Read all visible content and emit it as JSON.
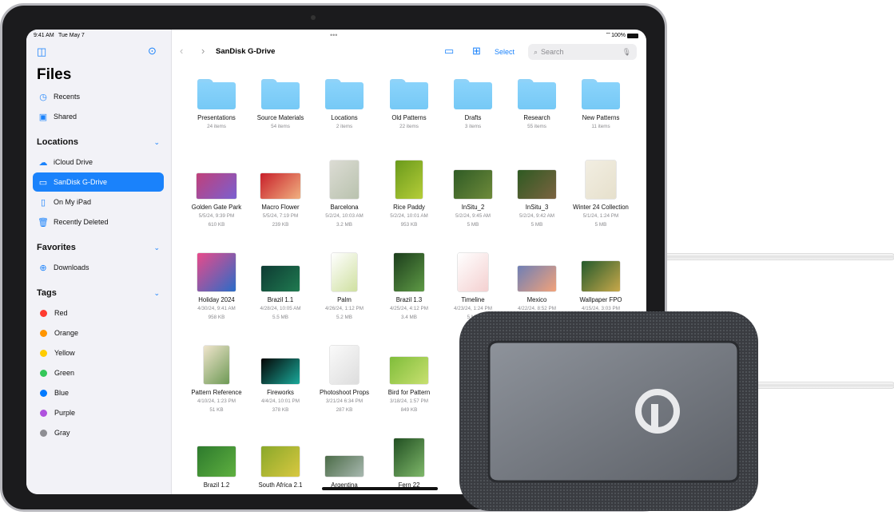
{
  "status": {
    "time": "9:41 AM",
    "date": "Tue May 7",
    "battery": "100%"
  },
  "sidebar": {
    "title": "Files",
    "top": [
      {
        "label": "Recents",
        "icon": "clock-icon"
      },
      {
        "label": "Shared",
        "icon": "shared-folder-icon"
      }
    ],
    "locations_header": "Locations",
    "locations": [
      {
        "label": "iCloud Drive",
        "icon": "cloud-icon"
      },
      {
        "label": "SanDisk G-Drive",
        "icon": "drive-icon",
        "selected": true
      },
      {
        "label": "On My iPad",
        "icon": "ipad-icon"
      },
      {
        "label": "Recently Deleted",
        "icon": "trash-icon"
      }
    ],
    "favorites_header": "Favorites",
    "favorites": [
      {
        "label": "Downloads",
        "icon": "download-icon"
      }
    ],
    "tags_header": "Tags",
    "tags": [
      {
        "label": "Red",
        "color": "#ff3b30"
      },
      {
        "label": "Orange",
        "color": "#ff9500"
      },
      {
        "label": "Yellow",
        "color": "#ffcc00"
      },
      {
        "label": "Green",
        "color": "#34c759"
      },
      {
        "label": "Blue",
        "color": "#007aff"
      },
      {
        "label": "Purple",
        "color": "#af52de"
      },
      {
        "label": "Gray",
        "color": "#8e8e93"
      }
    ]
  },
  "toolbar": {
    "title": "SanDisk G-Drive",
    "select": "Select",
    "search_placeholder": "Search"
  },
  "accent": "#1a82fb",
  "folders": [
    {
      "name": "Presentations",
      "meta": "24 items"
    },
    {
      "name": "Source Materials",
      "meta": "54 items"
    },
    {
      "name": "Locations",
      "meta": "2 items"
    },
    {
      "name": "Old Patterns",
      "meta": "22 items"
    },
    {
      "name": "Drafts",
      "meta": "3 items"
    },
    {
      "name": "Research",
      "meta": "55 items"
    },
    {
      "name": "New Patterns",
      "meta": "11 items"
    }
  ],
  "files": [
    [
      {
        "name": "Golden Gate Park",
        "date": "5/5/24, 9:39 PM",
        "size": "610 KB"
      },
      {
        "name": "Macro Flower",
        "date": "5/5/24, 7:19 PM",
        "size": "239 KB"
      },
      {
        "name": "Barcelona",
        "date": "5/2/24, 10:03 AM",
        "size": "3.2 MB"
      },
      {
        "name": "Rice Paddy",
        "date": "5/2/24, 10:01 AM",
        "size": "953 KB"
      },
      {
        "name": "InSitu_2",
        "date": "5/2/24, 9:45 AM",
        "size": "5 MB"
      },
      {
        "name": "InSitu_3",
        "date": "5/2/24, 9:42 AM",
        "size": "5 MB"
      },
      {
        "name": "Winter 24 Collection",
        "date": "5/1/24, 1:24 PM",
        "size": "5 MB"
      }
    ],
    [
      {
        "name": "Holiday 2024",
        "date": "4/30/24, 9:41 AM",
        "size": "958 KB"
      },
      {
        "name": "Brazil 1.1",
        "date": "4/28/24, 10:05 AM",
        "size": "5.5 MB"
      },
      {
        "name": "Palm",
        "date": "4/26/24, 1:12 PM",
        "size": "5.2 MB"
      },
      {
        "name": "Brazil 1.3",
        "date": "4/25/24, 4:12 PM",
        "size": "3.4 MB"
      },
      {
        "name": "Timeline",
        "date": "4/23/24, 1:24 PM",
        "size": "5 MB"
      },
      {
        "name": "Mexico",
        "date": "4/22/24, 8:52 PM",
        "size": ""
      },
      {
        "name": "Wallpaper FPO",
        "date": "4/15/24, 3:03 PM",
        "size": ""
      }
    ],
    [
      {
        "name": "Pattern Reference",
        "date": "4/10/24, 1:23 PM",
        "size": "51 KB"
      },
      {
        "name": "Fireworks",
        "date": "4/4/24, 10:01 PM",
        "size": "378 KB"
      },
      {
        "name": "Photoshoot Props",
        "date": "3/21/24 6:34 PM",
        "size": "287 KB"
      },
      {
        "name": "Bird for Pattern",
        "date": "3/18/24, 1:57 PM",
        "size": "849 KB"
      }
    ],
    [
      {
        "name": "Brazil 1.2",
        "date": "",
        "size": ""
      },
      {
        "name": "South Africa 2.1",
        "date": "",
        "size": ""
      },
      {
        "name": "Argentina",
        "date": "",
        "size": ""
      },
      {
        "name": "Fern 22",
        "date": "",
        "size": ""
      }
    ]
  ]
}
